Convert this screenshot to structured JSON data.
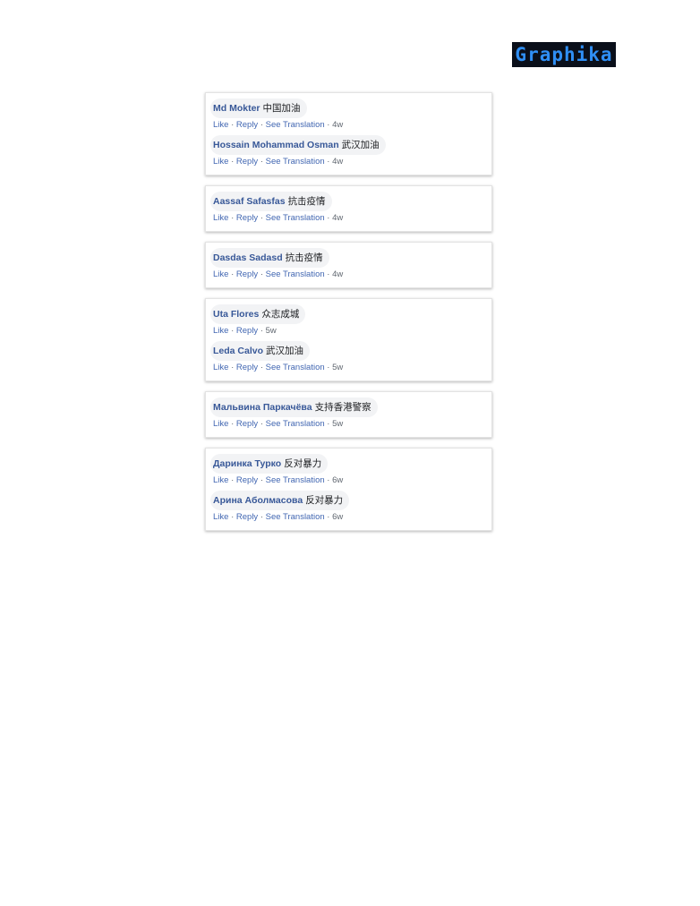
{
  "logo": {
    "text": "Graphika"
  },
  "separator": " · ",
  "cards": [
    {
      "comments": [
        {
          "author": "Md Mokter",
          "text": "中国加油",
          "actions": [
            "Like",
            "Reply",
            "See Translation"
          ],
          "time": "4w"
        },
        {
          "author": "Hossain Mohammad Osman",
          "text": "武汉加油",
          "actions": [
            "Like",
            "Reply",
            "See Translation"
          ],
          "time": "4w"
        }
      ]
    },
    {
      "comments": [
        {
          "author": "Aassaf Safasfas",
          "text": "抗击疫情",
          "actions": [
            "Like",
            "Reply",
            "See Translation"
          ],
          "time": "4w"
        }
      ]
    },
    {
      "comments": [
        {
          "author": "Dasdas Sadasd",
          "text": "抗击疫情",
          "actions": [
            "Like",
            "Reply",
            "See Translation"
          ],
          "time": "4w"
        }
      ]
    },
    {
      "comments": [
        {
          "author": "Uta Flores",
          "text": "众志成城",
          "actions": [
            "Like",
            "Reply"
          ],
          "time": "5w"
        },
        {
          "author": "Leda Calvo",
          "text": "武汉加油",
          "actions": [
            "Like",
            "Reply",
            "See Translation"
          ],
          "time": "5w"
        }
      ]
    },
    {
      "comments": [
        {
          "author": "Мальвина Паркачёва",
          "text": "支持香港警察",
          "actions": [
            "Like",
            "Reply",
            "See Translation"
          ],
          "time": "5w"
        }
      ]
    },
    {
      "comments": [
        {
          "author": "Даринка Турко",
          "text": "反对暴力",
          "actions": [
            "Like",
            "Reply",
            "See Translation"
          ],
          "time": "6w"
        },
        {
          "author": "Арина Аболмасова",
          "text": "反对暴力",
          "actions": [
            "Like",
            "Reply",
            "See Translation"
          ],
          "time": "6w"
        }
      ]
    }
  ]
}
